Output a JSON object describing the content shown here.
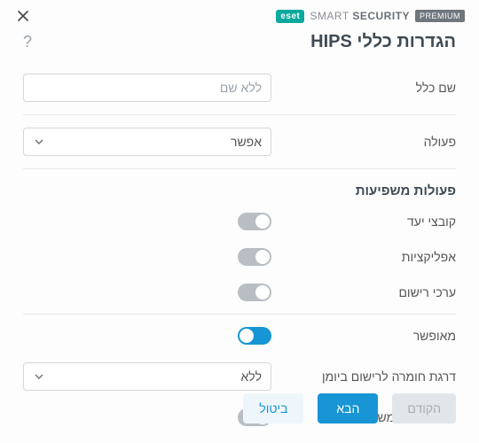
{
  "brand": {
    "logo_text": "eset",
    "product_a": "SMART",
    "product_b": "SECURITY",
    "badge": "PREMIUM"
  },
  "title": "הגדרות כללי HIPS",
  "fields": {
    "rule_name_label": "שם כלל",
    "rule_name_placeholder": "ללא שם",
    "action_label": "פעולה",
    "action_value": "אפשר"
  },
  "section_affecting": "פעולות משפיעות",
  "toggles": {
    "target_files": {
      "label": "קובצי יעד",
      "on": false
    },
    "applications": {
      "label": "אפליקציות",
      "on": false
    },
    "registry": {
      "label": "ערכי רישום",
      "on": false
    },
    "enabled": {
      "label": "מאופשר",
      "on": true
    },
    "notify_user": {
      "label": "הודע למשתמש",
      "on": false
    }
  },
  "severity": {
    "label": "דרגת חומרה לרישום ביומן",
    "value": "ללא"
  },
  "buttons": {
    "prev": "הקודם",
    "next": "הבא",
    "cancel": "ביטול"
  }
}
